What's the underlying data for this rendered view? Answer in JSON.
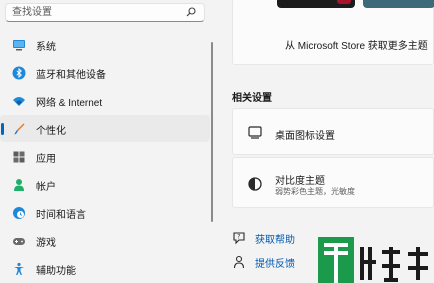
{
  "search": {
    "placeholder": "查找设置"
  },
  "sidebar": {
    "items": [
      {
        "label": "系统",
        "icon": "monitor-icon"
      },
      {
        "label": "蓝牙和其他设备",
        "icon": "bluetooth-icon"
      },
      {
        "label": "网络 & Internet",
        "icon": "wifi-icon"
      },
      {
        "label": "个性化",
        "icon": "brush-icon",
        "selected": true
      },
      {
        "label": "应用",
        "icon": "apps-icon"
      },
      {
        "label": "帐户",
        "icon": "person-icon"
      },
      {
        "label": "时间和语言",
        "icon": "globe-clock-icon"
      },
      {
        "label": "游戏",
        "icon": "gamepad-icon"
      },
      {
        "label": "辅助功能",
        "icon": "accessibility-icon"
      }
    ]
  },
  "main": {
    "store_link": "从 Microsoft Store 获取更多主题",
    "related_section_title": "相关设置",
    "cards": [
      {
        "title": "桌面图标设置",
        "subtitle": "",
        "icon": "desktop-icon"
      },
      {
        "title": "对比度主题",
        "subtitle": "弱势彩色主题，光敏度",
        "icon": "contrast-icon"
      }
    ],
    "help_links": [
      {
        "label": "获取帮助",
        "icon": "help-icon"
      },
      {
        "label": "提供反馈",
        "icon": "feedback-icon"
      }
    ]
  },
  "colors": {
    "accent": "#0067c0",
    "link": "#0059b3",
    "background": "#f3f3f3",
    "card": "#fbfbfb",
    "watermark_green": "#1a9a4a"
  },
  "watermark": {
    "text": "系统"
  }
}
